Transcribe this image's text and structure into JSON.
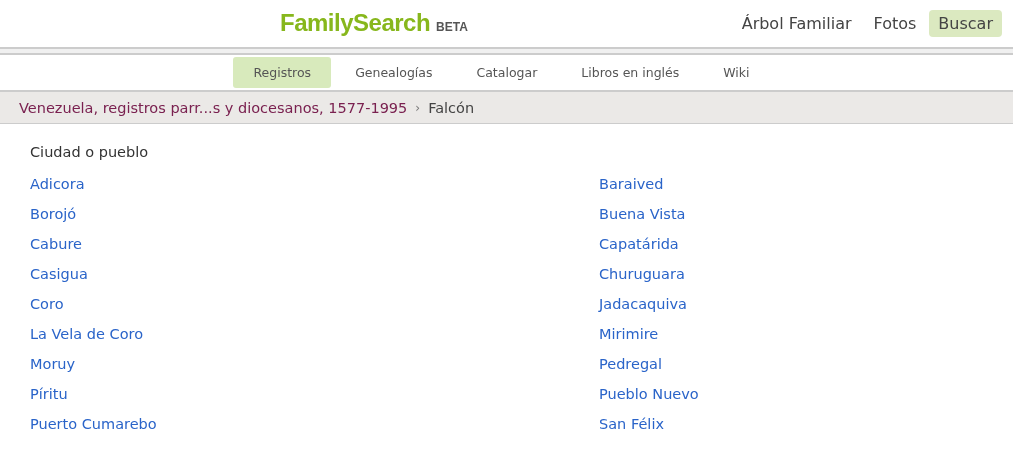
{
  "logo": {
    "name": "FamilySearch",
    "badge": "BETA"
  },
  "top_nav": [
    {
      "label": "Árbol Familiar",
      "selected": false
    },
    {
      "label": "Fotos",
      "selected": false
    },
    {
      "label": "Buscar",
      "selected": true
    }
  ],
  "sub_nav": [
    {
      "label": "Registros",
      "selected": true
    },
    {
      "label": "Genealogías",
      "selected": false
    },
    {
      "label": "Catalogar",
      "selected": false
    },
    {
      "label": "Libros en inglés",
      "selected": false
    },
    {
      "label": "Wiki",
      "selected": false
    }
  ],
  "breadcrumb": {
    "link": "Venezuela, registros parr...s y diocesanos, 1577-1995",
    "separator": "›",
    "current": "Falcón"
  },
  "section_title": "Ciudad o pueblo",
  "places": [
    [
      "Adicora",
      "Borojó",
      "Cabure",
      "Casigua",
      "Coro",
      "La Vela de Coro",
      "Moruy",
      "Píritu",
      "Puerto Cumarebo"
    ],
    [
      "Baraived",
      "Buena Vista",
      "Capatárida",
      "Churuguara",
      "Jadacaquiva",
      "Mirimire",
      "Pedregal",
      "Pueblo Nuevo",
      "San Félix"
    ]
  ]
}
